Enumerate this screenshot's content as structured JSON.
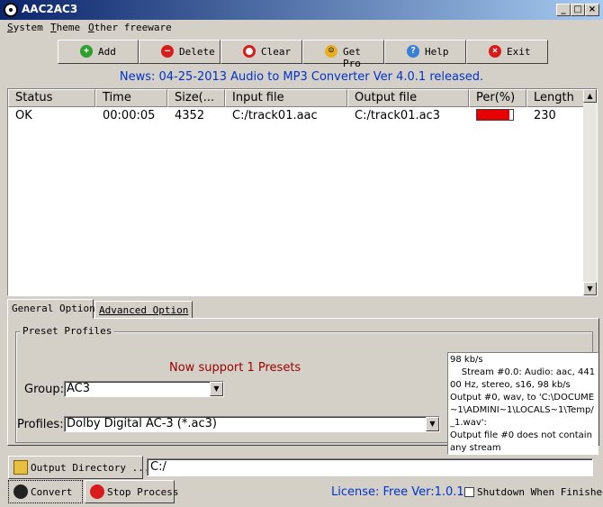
{
  "window": {
    "title": "AAC2AC3",
    "controls": [
      "_",
      "□",
      "×"
    ]
  },
  "menu": [
    "System",
    "Theme",
    "Other freeware"
  ],
  "toolbar": {
    "add": "Add",
    "delete": "Delete",
    "clear": "Clear",
    "get_pro": "Get Pro",
    "help": "Help",
    "exit": "Exit"
  },
  "news": "News: 04-25-2013 Audio to MP3 Converter Ver 4.0.1 released.",
  "grid": {
    "columns": [
      "Status",
      "Time",
      "Size(...",
      "Input file",
      "Output file",
      "Per(%)",
      "Length"
    ],
    "rows": [
      {
        "status": "OK",
        "time": "00:00:05",
        "size": "4352",
        "input": "C:/track01.aac",
        "output": "C:/track01.ac3",
        "percent": 90,
        "length": "230"
      }
    ]
  },
  "tabs": [
    "General Option",
    "Advanced Option"
  ],
  "preset": {
    "legend": "Preset Profiles",
    "support_text": "Now support 1 Presets",
    "group_label": "Group:",
    "group_value": "AC3",
    "profiles_label": "Profiles:",
    "profiles_value": "Dolby Digital AC-3 (*.ac3)"
  },
  "log": [
    "98 kb/s",
    "    Stream #0.0: Audio: aac, 44100 Hz, stereo, s16, 98 kb/s",
    "Output #0, wav, to 'C:\\DOCUME~1\\ADMINI~1\\LOCALS~1\\Temp/_1.wav':",
    "Output file #0 does not contain any stream"
  ],
  "bottom": {
    "output_dir_button": "Output Directory ...",
    "output_dir_value": "C:/",
    "convert": "Convert",
    "stop": "Stop Process",
    "license": "License: Free Ver:1.0.1",
    "shutdown": "Shutdown When Finished"
  },
  "colors": {
    "title_bar": "#0a246a",
    "news": "#0033cc",
    "progress": "#e60000",
    "support": "#990000"
  }
}
